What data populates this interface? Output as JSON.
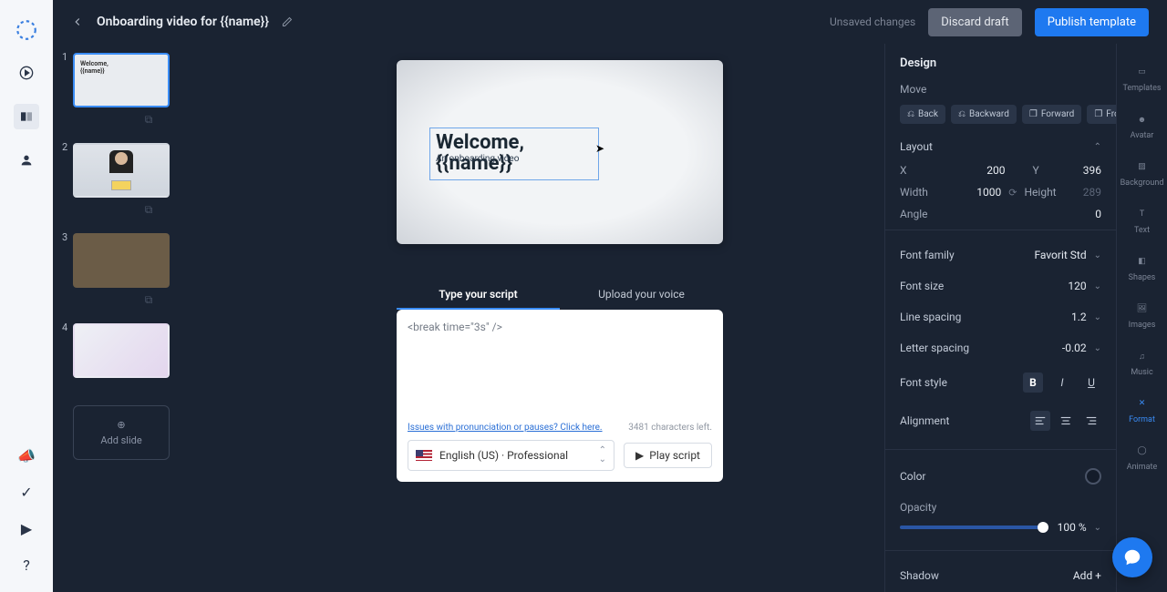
{
  "header": {
    "title": "Onboarding video for {{name}}",
    "unsaved": "Unsaved changes",
    "discard": "Discard draft",
    "publish": "Publish template"
  },
  "slides": {
    "s1": {
      "num": "1",
      "line1": "Welcome,",
      "line2": "{{name}}",
      "sub": "..."
    },
    "s2": {
      "num": "2"
    },
    "s3": {
      "num": "3"
    },
    "s4": {
      "num": "4"
    },
    "add": "Add slide"
  },
  "canvas": {
    "line1": "Welcome,",
    "subtitle": "An onboarding video",
    "line2": "{{name}}"
  },
  "script": {
    "tab1": "Type your script",
    "tab2": "Upload your voice",
    "text": "<break time=\"3s\" />",
    "help": "Issues with pronunciation or pauses? Click here.",
    "chars": "3481 characters left.",
    "voice": "English (US) · Professional",
    "play": "Play script"
  },
  "design": {
    "title": "Design",
    "move": {
      "label": "Move",
      "back": "Back",
      "backward": "Backward",
      "forward": "Forward",
      "front": "Front"
    },
    "layout": {
      "label": "Layout",
      "x": "X",
      "xval": "200",
      "y": "Y",
      "yval": "396",
      "w": "Width",
      "wval": "1000",
      "h": "Height",
      "hval": "289",
      "angle": "Angle",
      "angleval": "0"
    },
    "fontfamily": {
      "label": "Font family",
      "val": "Favorit Std"
    },
    "fontsize": {
      "label": "Font size",
      "val": "120"
    },
    "linespacing": {
      "label": "Line spacing",
      "val": "1.2"
    },
    "letterspacing": {
      "label": "Letter spacing",
      "val": "-0.02"
    },
    "fontstyle": {
      "label": "Font style"
    },
    "alignment": {
      "label": "Alignment"
    },
    "color": {
      "label": "Color"
    },
    "opacity": {
      "label": "Opacity",
      "val": "100 %"
    },
    "shadow": {
      "label": "Shadow",
      "add": "Add +"
    }
  },
  "rightRail": {
    "templates": "Templates",
    "avatar": "Avatar",
    "background": "Background",
    "text": "Text",
    "shapes": "Shapes",
    "images": "Images",
    "music": "Music",
    "format": "Format",
    "animate": "Animate"
  }
}
